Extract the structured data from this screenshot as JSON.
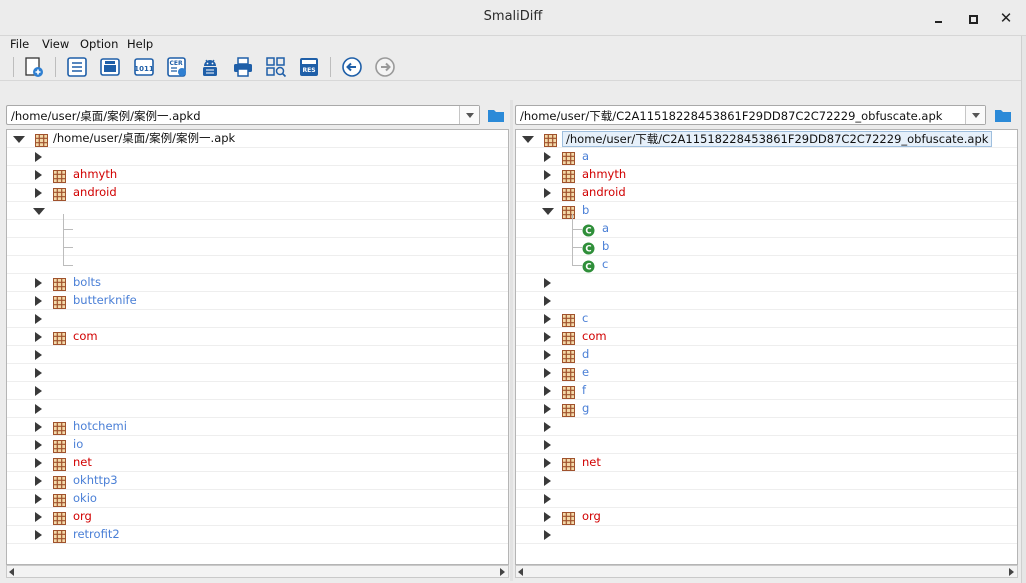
{
  "window": {
    "title": "SmaliDiff"
  },
  "menu": [
    "File",
    "View",
    "Option",
    "Help"
  ],
  "toolbar_icons": [
    "new-file-icon",
    "list-icon",
    "image-icon",
    "binary-icon",
    "certificate-icon",
    "android-icon",
    "print-icon",
    "grid-search-icon",
    "resource-icon",
    "back-icon",
    "forward-icon"
  ],
  "left": {
    "path": "/home/user/桌面/案例/案例一.apkd",
    "root_label": "/home/user/桌面/案例/案例一.apk",
    "items": [
      {
        "label": "",
        "kind": "empty",
        "state": "collapsed"
      },
      {
        "label": "ahmyth",
        "kind": "pkg",
        "color": "red",
        "state": "collapsed"
      },
      {
        "label": "android",
        "kind": "pkg",
        "color": "red",
        "state": "collapsed"
      },
      {
        "label": "",
        "kind": "empty",
        "state": "expanded"
      },
      {
        "label": "",
        "kind": "child"
      },
      {
        "label": "",
        "kind": "child"
      },
      {
        "label": "",
        "kind": "child"
      },
      {
        "label": "bolts",
        "kind": "pkg",
        "color": "blue",
        "state": "collapsed"
      },
      {
        "label": "butterknife",
        "kind": "pkg",
        "color": "blue",
        "state": "collapsed"
      },
      {
        "label": "",
        "kind": "empty",
        "state": "collapsed"
      },
      {
        "label": "com",
        "kind": "pkg",
        "color": "red",
        "state": "collapsed"
      },
      {
        "label": "",
        "kind": "empty",
        "state": "collapsed"
      },
      {
        "label": "",
        "kind": "empty",
        "state": "collapsed"
      },
      {
        "label": "",
        "kind": "empty",
        "state": "collapsed"
      },
      {
        "label": "",
        "kind": "empty",
        "state": "collapsed"
      },
      {
        "label": "hotchemi",
        "kind": "pkg",
        "color": "blue",
        "state": "collapsed"
      },
      {
        "label": "io",
        "kind": "pkg",
        "color": "blue",
        "state": "collapsed"
      },
      {
        "label": "net",
        "kind": "pkg",
        "color": "red",
        "state": "collapsed"
      },
      {
        "label": "okhttp3",
        "kind": "pkg",
        "color": "blue",
        "state": "collapsed"
      },
      {
        "label": "okio",
        "kind": "pkg",
        "color": "blue",
        "state": "collapsed"
      },
      {
        "label": "org",
        "kind": "pkg",
        "color": "red",
        "state": "collapsed"
      },
      {
        "label": "retrofit2",
        "kind": "pkg",
        "color": "blue",
        "state": "collapsed"
      }
    ]
  },
  "right": {
    "path": "/home/user/下载/C2A11518228453861F29DD87C2C72229_obfuscate.apk",
    "root_label": "/home/user/下载/C2A11518228453861F29DD87C2C72229_obfuscate.apk",
    "items": [
      {
        "label": "a",
        "kind": "pkg",
        "color": "blue",
        "state": "collapsed"
      },
      {
        "label": "ahmyth",
        "kind": "pkg",
        "color": "red",
        "state": "collapsed"
      },
      {
        "label": "android",
        "kind": "pkg",
        "color": "red",
        "state": "collapsed"
      },
      {
        "label": "b",
        "kind": "pkg",
        "color": "blue",
        "state": "expanded"
      },
      {
        "label": "a",
        "kind": "class",
        "color": "blue"
      },
      {
        "label": "b",
        "kind": "class",
        "color": "blue"
      },
      {
        "label": "c",
        "kind": "class",
        "color": "blue"
      },
      {
        "label": "",
        "kind": "empty",
        "state": "collapsed"
      },
      {
        "label": "",
        "kind": "empty",
        "state": "collapsed"
      },
      {
        "label": "c",
        "kind": "pkg",
        "color": "blue",
        "state": "collapsed"
      },
      {
        "label": "com",
        "kind": "pkg",
        "color": "red",
        "state": "collapsed"
      },
      {
        "label": "d",
        "kind": "pkg",
        "color": "blue",
        "state": "collapsed"
      },
      {
        "label": "e",
        "kind": "pkg",
        "color": "blue",
        "state": "collapsed"
      },
      {
        "label": "f",
        "kind": "pkg",
        "color": "blue",
        "state": "collapsed"
      },
      {
        "label": "g",
        "kind": "pkg",
        "color": "blue",
        "state": "collapsed"
      },
      {
        "label": "",
        "kind": "empty",
        "state": "collapsed"
      },
      {
        "label": "",
        "kind": "empty",
        "state": "collapsed"
      },
      {
        "label": "net",
        "kind": "pkg",
        "color": "red",
        "state": "collapsed"
      },
      {
        "label": "",
        "kind": "empty",
        "state": "collapsed"
      },
      {
        "label": "",
        "kind": "empty",
        "state": "collapsed"
      },
      {
        "label": "org",
        "kind": "pkg",
        "color": "red",
        "state": "collapsed"
      },
      {
        "label": "",
        "kind": "empty",
        "state": "collapsed"
      }
    ]
  },
  "colors": {
    "red": "#d10000",
    "blue": "#4a7fd6",
    "class_green": "#2f8f3a",
    "package_brown": "#a0522d"
  }
}
